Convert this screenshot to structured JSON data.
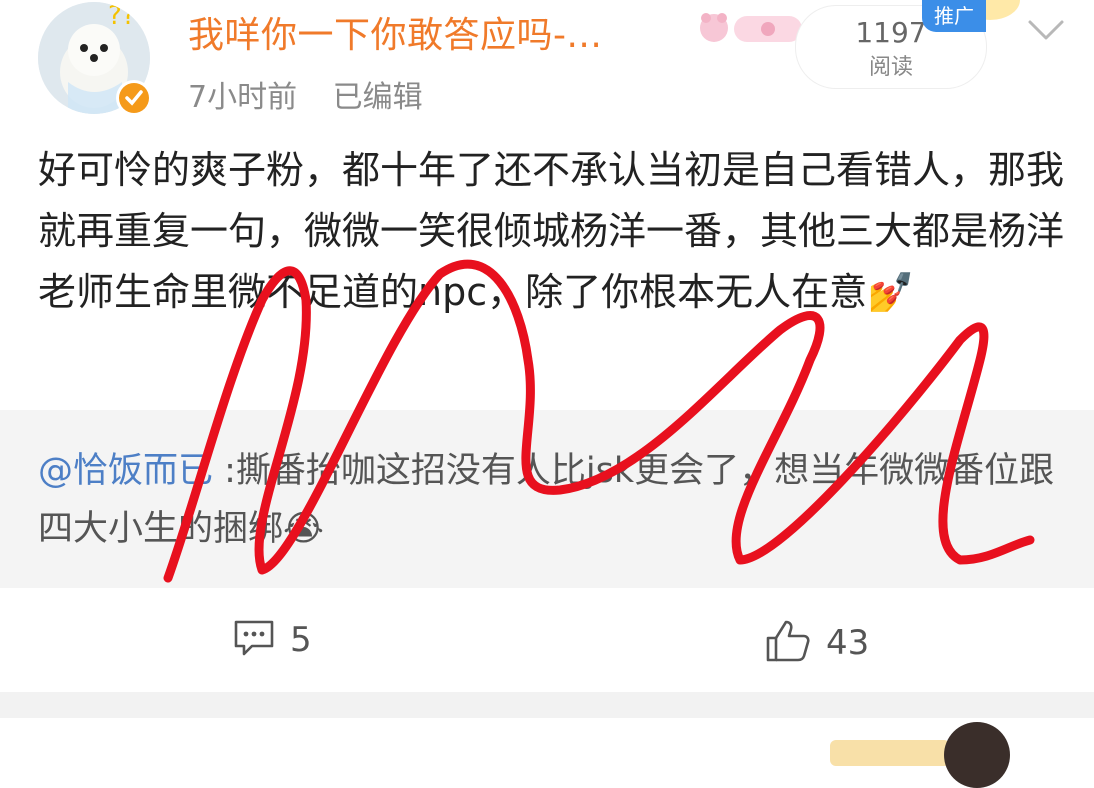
{
  "post": {
    "username": "我咩你一下你敢答应吗-...",
    "time": "7小时前",
    "edited": "已编辑",
    "read_count": "1197",
    "read_label": "阅读",
    "promo_tag": "推广",
    "body": "好可怜的爽子粉，都十年了还不承认当初是自己看错人，那我就再重复一句，微微一笑很倾城杨洋一番，其他三大都是杨洋老师生命里微不足道的npc，除了你根本无人在意💅",
    "quote": {
      "handle": "@恰饭而已",
      "text": " :撕番抬咖这招没有人比jsk更会了，想当年微微番位跟四大小生的捆绑😭"
    },
    "comments": "5",
    "likes": "43"
  },
  "icons": {
    "comment": "comment-icon",
    "like": "thumbs-up-icon",
    "menu": "chevron-down-icon",
    "verified": "verified-badge-icon"
  },
  "colors": {
    "username": "#f07a2a",
    "handle": "#4d7fc6",
    "scribble": "#e8101e",
    "promo": "#3b8ee8"
  }
}
